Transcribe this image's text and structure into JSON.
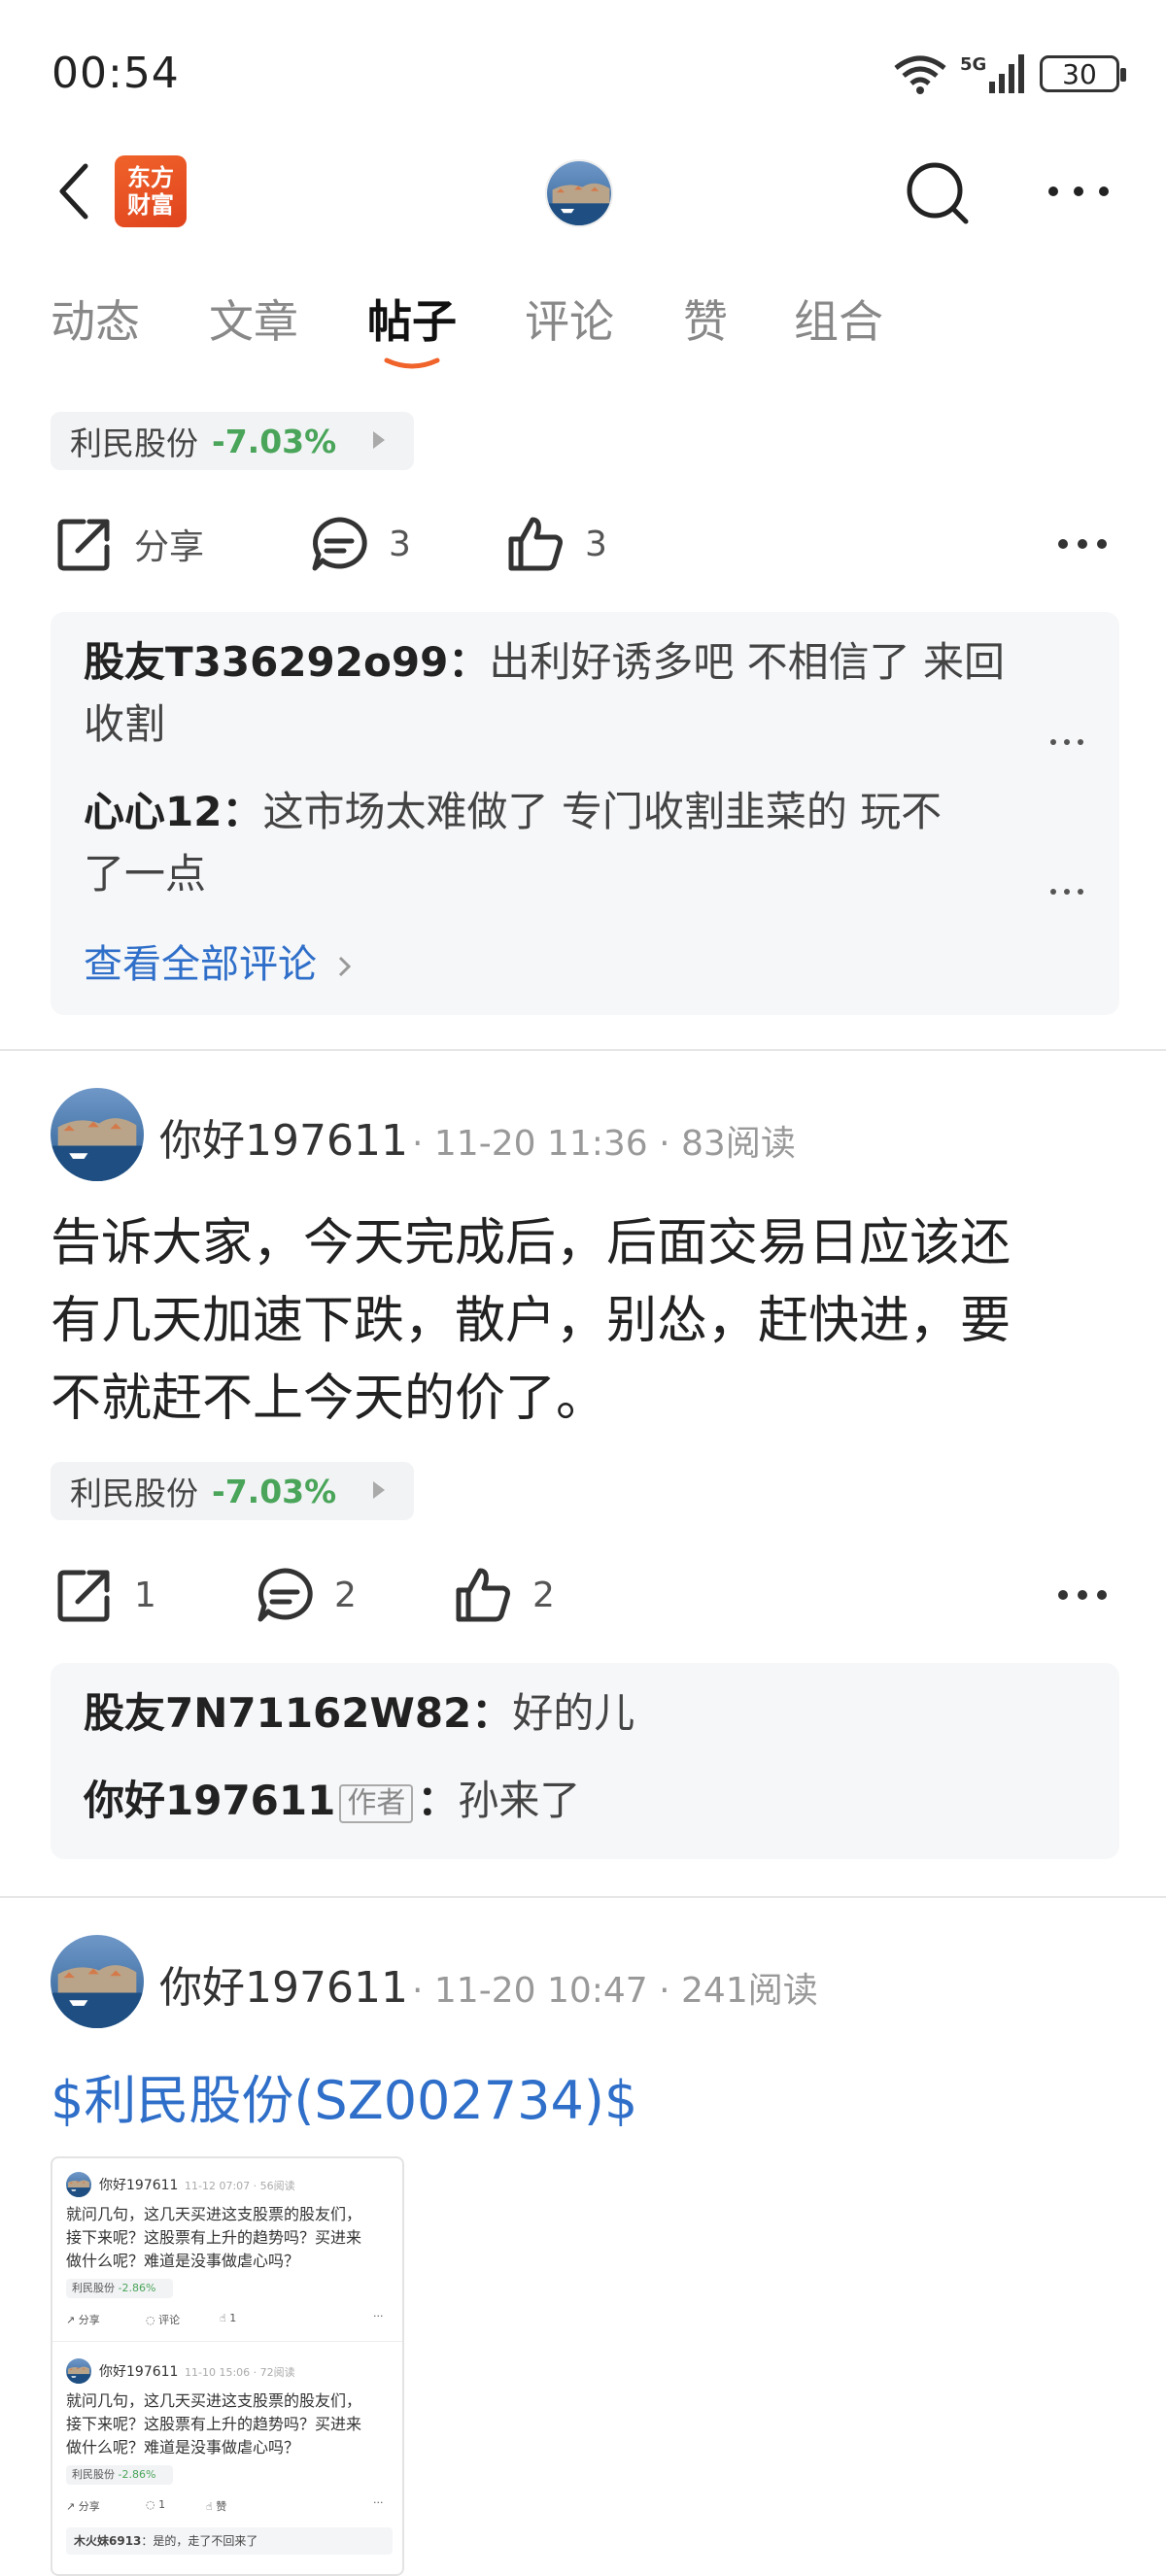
{
  "status_bar": {
    "time": "00:54",
    "battery": "30"
  },
  "nav": {
    "logo_line1": "东方",
    "logo_line2": "财富"
  },
  "tabs": [
    "动态",
    "文章",
    "帖子",
    "评论",
    "赞",
    "组合"
  ],
  "active_tab": "帖子",
  "accent": "#2f6fc9",
  "down_color": "#4aa55a",
  "post0": {
    "stock": {
      "name": "利民股份",
      "change": "-7.03%"
    },
    "actions": {
      "share": "分享",
      "comments": "3",
      "likes": "3"
    },
    "comments": [
      {
        "user": "股友T336292o99",
        "text": "出利好诱多吧 不相信了 来回",
        "text2": "收割"
      },
      {
        "user": "心心12",
        "text": "这市场太难做了 专门收割韭菜的 玩不",
        "text2": "了一点"
      }
    ],
    "view_all": "查看全部评论"
  },
  "post1": {
    "user": "你好197611",
    "date": "11-20 11:36",
    "reads": "83阅读",
    "body_lines": [
      "告诉大家，今天完成后，后面交易日应该还",
      "有几天加速下跌，散户，别怂，赶快进，要",
      "不就赶不上今天的价了。"
    ],
    "stock": {
      "name": "利民股份",
      "change": "-7.03%"
    },
    "actions": {
      "share": "1",
      "comments": "2",
      "likes": "2"
    },
    "comments": [
      {
        "user": "股友7N71162W82",
        "text": "好的儿"
      },
      {
        "user": "你好197611",
        "tag": "作者",
        "text": "孙来了"
      }
    ]
  },
  "post2": {
    "user": "你好197611",
    "date": "11-20 10:47",
    "reads": "241阅读",
    "link": "$利民股份(SZ002734)$",
    "thumb": {
      "a_user": "你好197611",
      "a_meta": "11-12 07:07 · 56阅读",
      "a_body1": "就问几句，这几天买进这支股票的股友们，",
      "a_body2": "接下来呢？这股票有上升的趋势吗？买进来",
      "a_body3": "做什么呢？难道是没事做虐心吗？",
      "a_chip": "利民股份",
      "a_chip_pct": "-2.86%",
      "a_share": "分享",
      "a_comment": "评论",
      "a_like": "1",
      "b_user": "你好197611",
      "b_meta": "11-10 15:06 · 72阅读",
      "b_body1": "就问几句，这几天买进这支股票的股友们，",
      "b_body2": "接下来呢？这股票有上升的趋势吗？买进来",
      "b_body3": "做什么呢？难道是没事做虐心吗？",
      "b_chip": "利民股份",
      "b_chip_pct": "-2.86%",
      "b_share": "分享",
      "b_comment": "1",
      "b_like": "赞",
      "b_reply_user": "木火妹6913",
      "b_reply_text": "是的，走了不回来了"
    }
  }
}
